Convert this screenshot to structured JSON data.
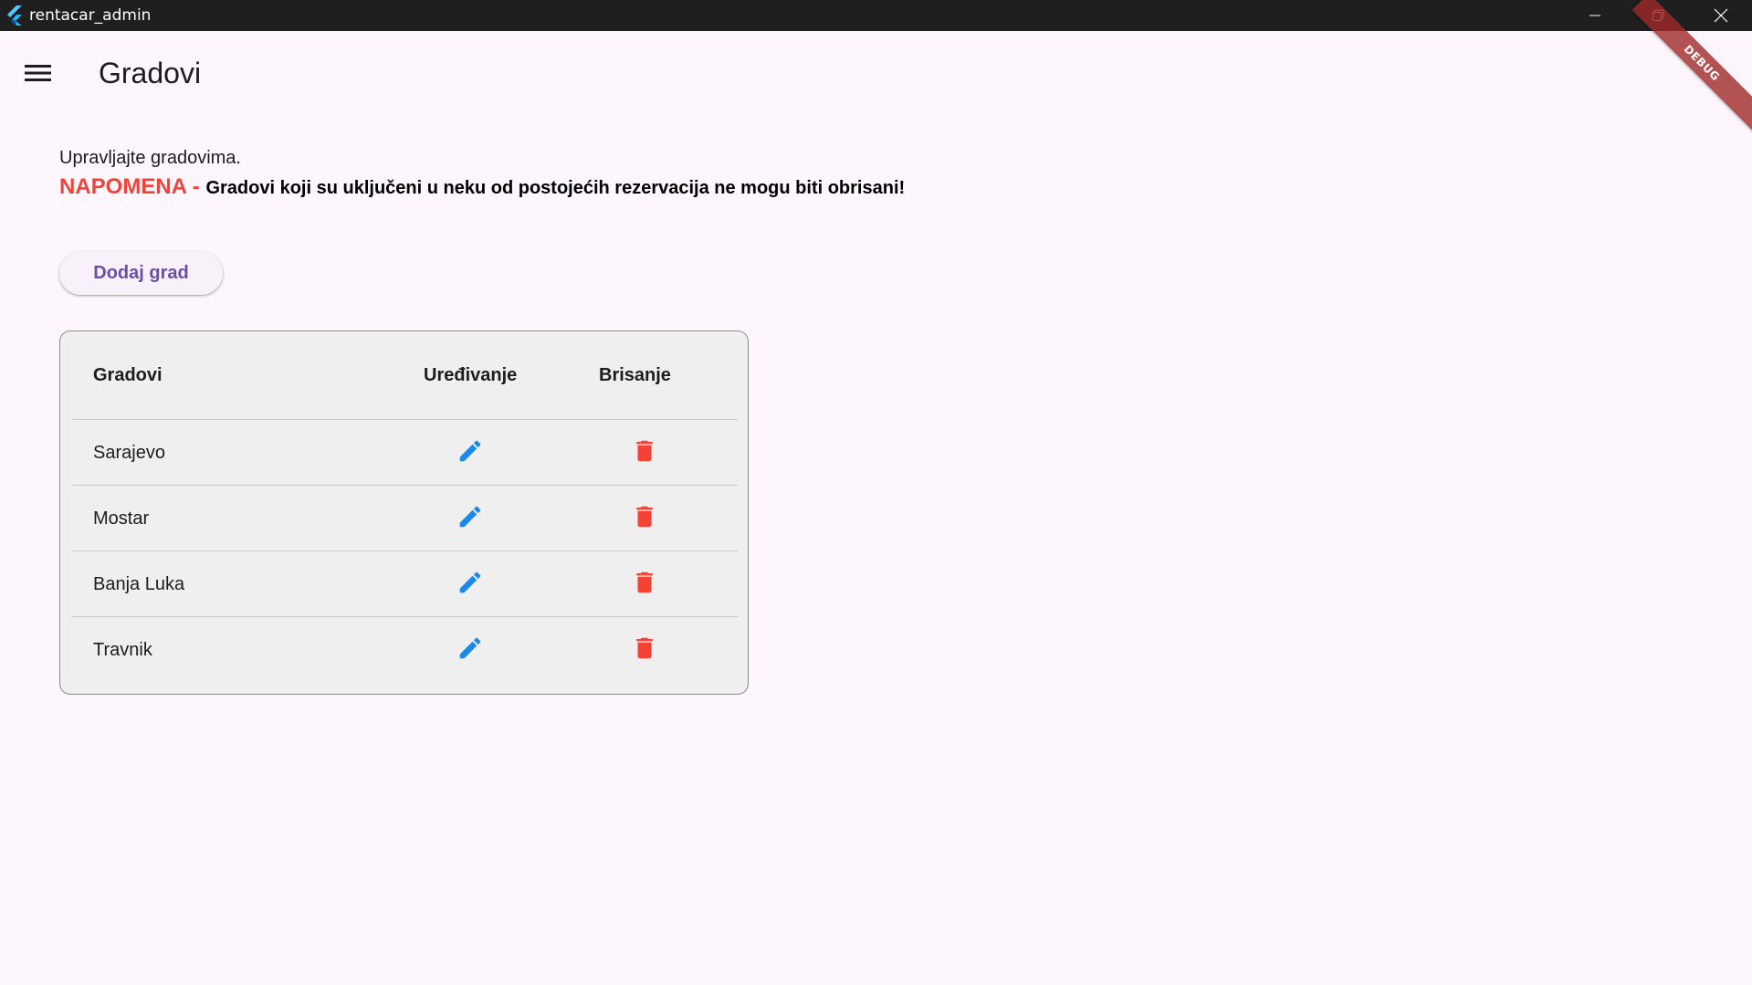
{
  "window": {
    "title": "rentacar_admin",
    "debug_banner": "DEBUG"
  },
  "appbar": {
    "title": "Gradovi",
    "menu_icon": "menu-icon"
  },
  "content": {
    "intro": "Upravljajte gradovima.",
    "note_label": "NAPOMENA - ",
    "note_text": "Gradovi koji su uključeni u neku od postojećih rezervacija ne mogu biti obrisani!",
    "add_button": "Dodaj grad"
  },
  "table": {
    "columns": [
      "Gradovi",
      "Uređivanje",
      "Brisanje"
    ],
    "rows": [
      {
        "city": "Sarajevo"
      },
      {
        "city": "Mostar"
      },
      {
        "city": "Banja Luka"
      },
      {
        "city": "Travnik"
      }
    ]
  },
  "colors": {
    "accent": "#6750a4",
    "warning": "#f0433a",
    "edit_icon": "#1e88e5",
    "delete_icon": "#f44336",
    "background": "#fdf7fd"
  }
}
